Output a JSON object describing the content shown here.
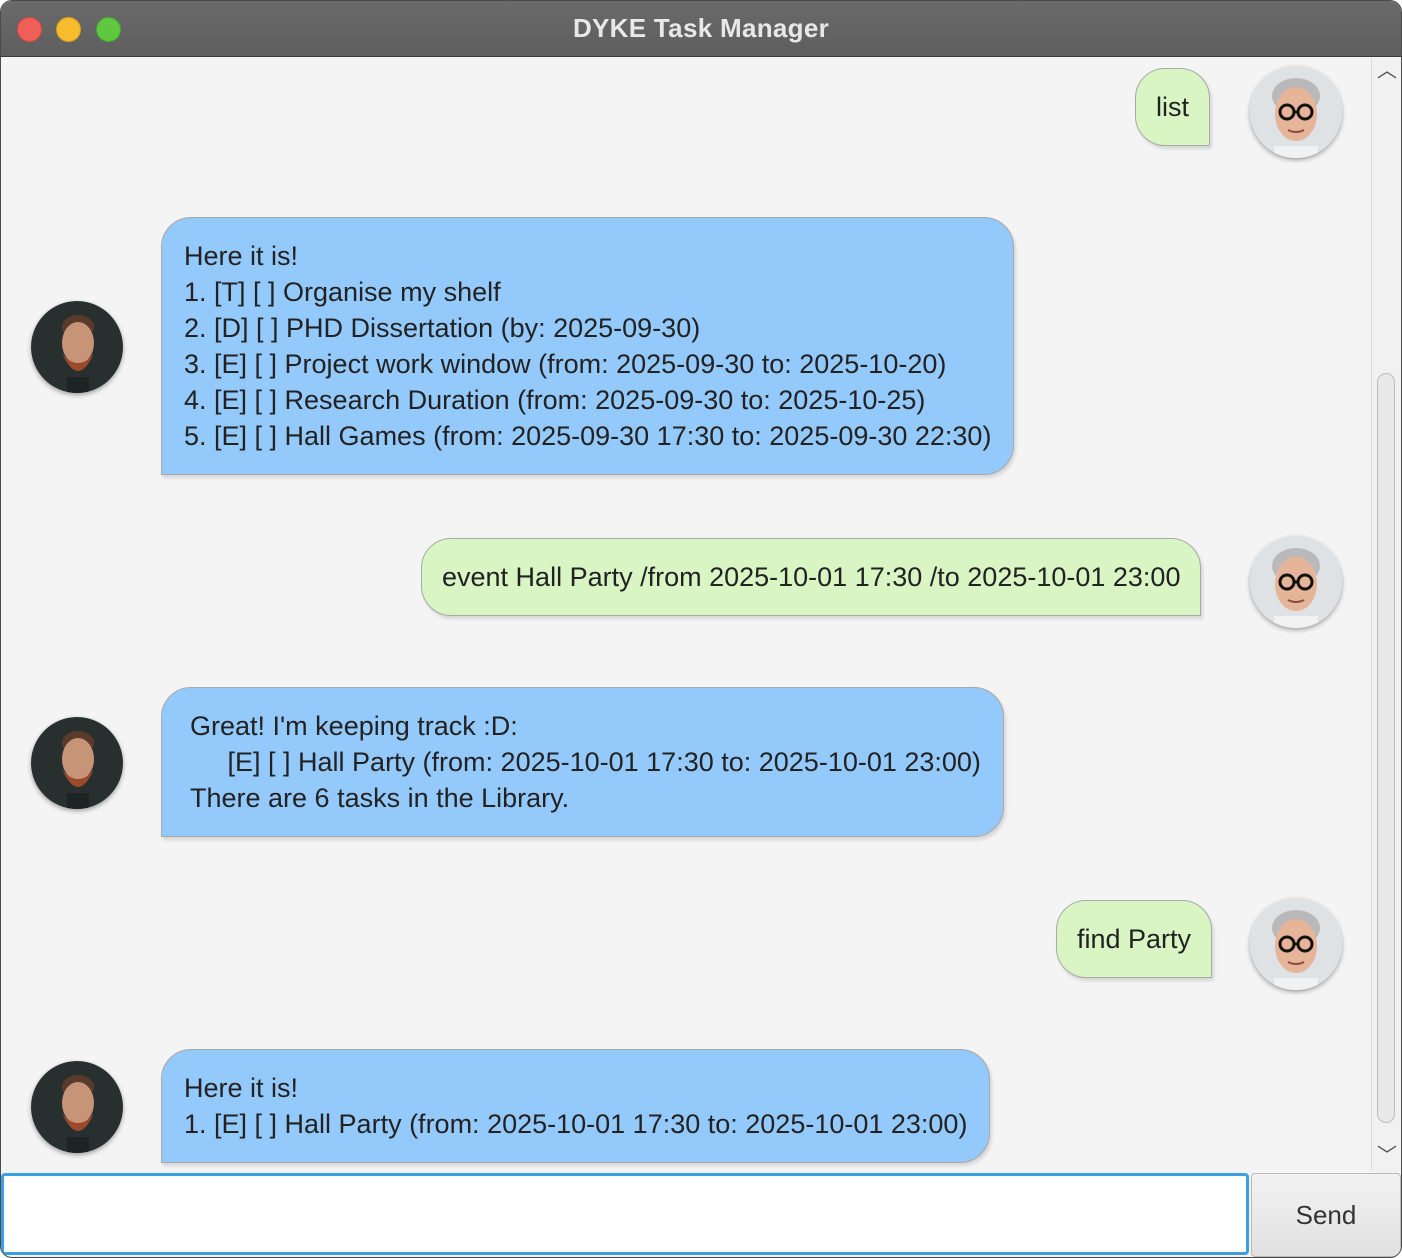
{
  "window": {
    "title": "DYKE Task Manager"
  },
  "messages": [
    {
      "from": "user",
      "text": "list"
    },
    {
      "from": "bot",
      "text": "Here it is!\n1. [T] [ ] Organise my shelf\n2. [D] [ ] PHD Dissertation (by: 2025-09-30)\n3. [E] [ ] Project work window (from: 2025-09-30 to: 2025-10-20)\n4. [E] [ ] Research Duration (from: 2025-09-30 to: 2025-10-25)\n5. [E] [ ] Hall Games (from: 2025-09-30 17:30 to: 2025-09-30 22:30)"
    },
    {
      "from": "user",
      "text": "event Hall Party /from 2025-10-01 17:30 /to 2025-10-01 23:00"
    },
    {
      "from": "bot",
      "text": "Great! I'm keeping track :D:\n     [E] [ ] Hall Party (from: 2025-10-01 17:30 to: 2025-10-01 23:00)\nThere are 6 tasks in the Library."
    },
    {
      "from": "user",
      "text": "find Party"
    },
    {
      "from": "bot",
      "text": "Here it is!\n1. [E] [ ] Hall Party (from: 2025-10-01 17:30 to: 2025-10-01 23:00)"
    }
  ],
  "input": {
    "value": "",
    "placeholder": ""
  },
  "send_button": {
    "label": "Send"
  },
  "colors": {
    "user_bubble": "#d9f5c4",
    "bot_bubble": "#94c9fc",
    "input_focus": "#3b9fe0"
  },
  "icons": {
    "user_avatar": "user-avatar-icon",
    "bot_avatar": "bot-avatar-icon"
  }
}
